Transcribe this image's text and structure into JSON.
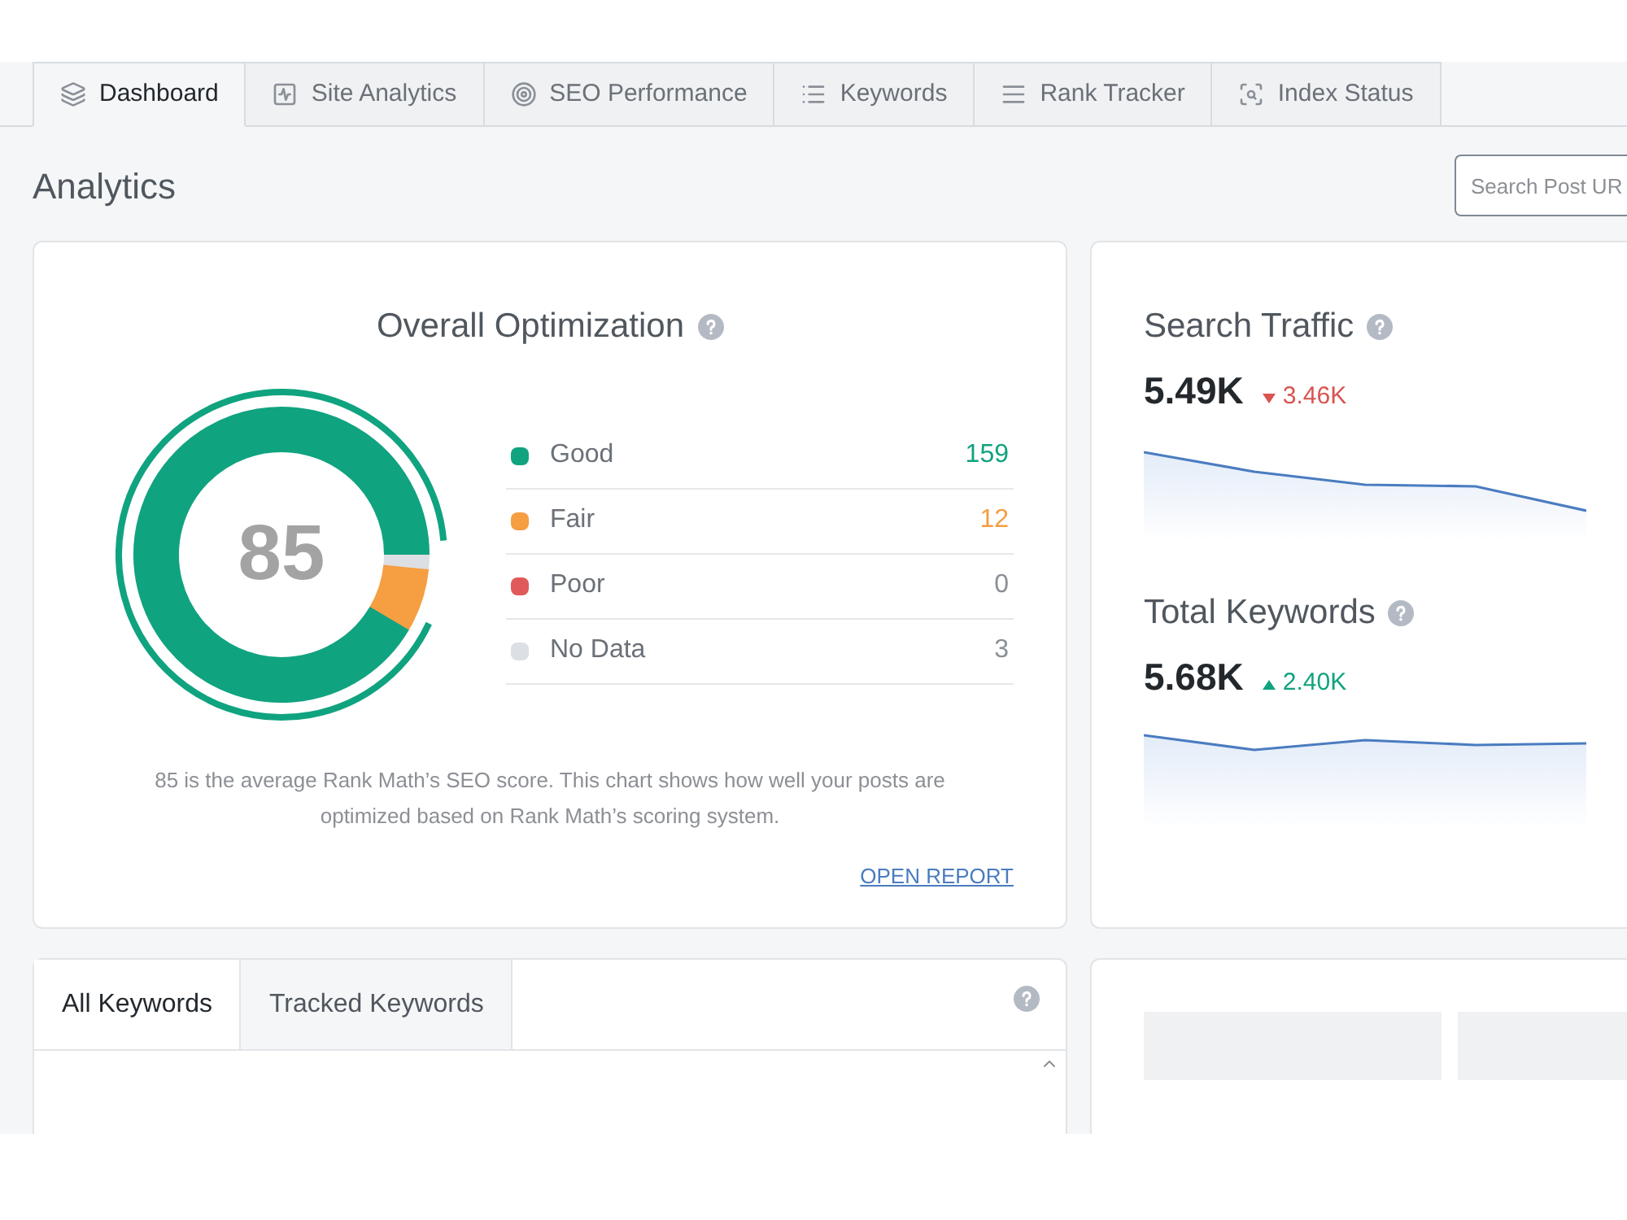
{
  "tabs": [
    {
      "label": "Dashboard",
      "selected": true
    },
    {
      "label": "Site Analytics",
      "selected": false
    },
    {
      "label": "SEO Performance",
      "selected": false
    },
    {
      "label": "Keywords",
      "selected": false
    },
    {
      "label": "Rank Tracker",
      "selected": false
    },
    {
      "label": "Index Status",
      "selected": false
    }
  ],
  "page_title": "Analytics",
  "search": {
    "placeholder": "Search Post UR"
  },
  "optimization": {
    "title": "Overall Optimization",
    "score": "85",
    "items": [
      {
        "label": "Good",
        "count": "159",
        "color": "#10a37f",
        "value_colored": true
      },
      {
        "label": "Fair",
        "count": "12",
        "color": "#f59e42",
        "value_colored": true
      },
      {
        "label": "Poor",
        "count": "0",
        "color": "#e05a5a",
        "value_colored": false
      },
      {
        "label": "No Data",
        "count": "3",
        "color": "#dcdfe3",
        "value_colored": false
      }
    ],
    "description": "85 is the average Rank Math’s SEO score. This chart shows how well your posts are optimized based on Rank Math’s scoring system.",
    "link": "OPEN REPORT"
  },
  "stats": [
    {
      "title": "Search Traffic",
      "value": "5.49K",
      "change": "3.46K",
      "rising": false
    },
    {
      "title": "Total Keywords",
      "value": "5.68K",
      "change": "2.40K",
      "rising": true
    }
  ],
  "keyword_tabs": [
    {
      "label": "All Keywords",
      "selected": true
    },
    {
      "label": "Tracked Keywords",
      "selected": false
    }
  ]
}
